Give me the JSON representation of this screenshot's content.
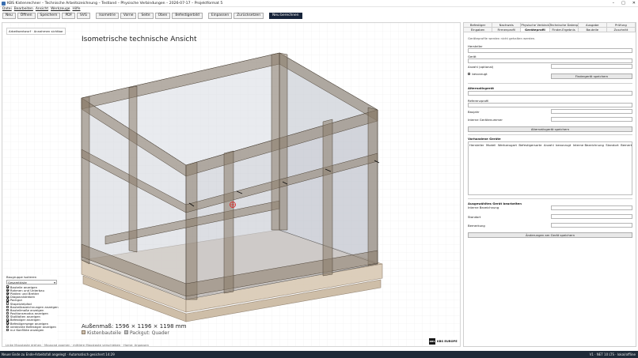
{
  "window": {
    "title": "KBS Kistenrechner – Technische Arbeitszeichnung – Testland – Physische Verbindungen – 2026-07-17 – Projektformat 5",
    "controls": [
      "–",
      "□",
      "✕"
    ]
  },
  "menu": [
    "Datei",
    "Bearbeiten",
    "Ansicht",
    "Werkzeuge",
    "Hilfe"
  ],
  "toolbar": {
    "new": "Neu",
    "open": "Öffnen",
    "save": "Speichern",
    "pdf": "PDF",
    "svg": "SVG",
    "isometric": "Isometrie",
    "front": "Vorne",
    "side": "Seite",
    "top": "Oben",
    "render": "Befestigerbild",
    "fit": "Einpassen",
    "reset": "Zurücksetzen",
    "recalc": "Neu berechnen"
  },
  "canvas": {
    "tab_label": "Arbeitsentwurf · Annahmen sichtbar",
    "title": "Isometrische technische Ansicht",
    "dimensions": "Außenmaß: 1596 × 1196 × 1198 mm",
    "legend": {
      "crate": "Kistenbauteile",
      "pack": "Packgut: Quader"
    },
    "logo_text": "KBS EUROPE",
    "logo_mark": "KBS",
    "hint": "Linke Maustaste drehen · Mausrad zoomen · mittlere Maustaste verschieben · Home: Anpassen"
  },
  "groups": {
    "title": "Baugruppe isolieren",
    "selected": "Gesamtkiste",
    "items": [
      {
        "label": "Bauteile anzeigen",
        "checked": true
      },
      {
        "label": "Rahmen und Unterbau",
        "checked": true
      },
      {
        "label": "Platten und Bretter",
        "checked": true
      },
      {
        "label": "Diagonalstreben",
        "checked": true
      },
      {
        "label": "Packgut",
        "checked": true
      },
      {
        "label": "Stapelzielpfad",
        "checked": false
      },
      {
        "label": "Bauteilbezeichnungen anzeigen",
        "checked": false
      },
      {
        "label": "Bauteilmaße anzeigen",
        "checked": false
      },
      {
        "label": "Positionsmodus anzeigen",
        "checked": false
      },
      {
        "label": "Stoßfalten anzeigen",
        "checked": false
      },
      {
        "label": "Befestiger anzeigen",
        "checked": true
      },
      {
        "label": "Befestigerwege anzeigen",
        "checked": true
      },
      {
        "label": "verdeckte Befestiger anzeigen",
        "checked": false
      },
      {
        "label": "nur Konflikte anzeigen",
        "checked": false
      }
    ]
  },
  "right_panel": {
    "tabs_row1": [
      "Befestiger",
      "Nachweis",
      "Physische Verbindungen",
      "Technische Datenpakete",
      "Ausgabe",
      "Prüfung"
    ],
    "tabs_row2": [
      "Eingaben",
      "Firmenprofil",
      "Geräteprofil",
      "Finder-Ergebnis",
      "Bauteile",
      "Zuschnitt"
    ],
    "active_tab": "Geräteprofil",
    "info": "Geräteprofile werden nicht gehalten werden.",
    "manufacturer_label": "Hersteller",
    "device_label": "Gerät",
    "count_label": "Anzahl (optional)",
    "preferred_label": "bevorzugt",
    "save_finder": "Findergerät speichern",
    "alt_title": "Alternativgerät",
    "reference_label": "Referenzprofil",
    "series_label": "Baujahr",
    "internal_no_label": "Interne Gerätenummer",
    "save_alt": "Alternativgerät speichern",
    "existing_title": "Vorhandene Geräte",
    "table_headers": [
      "Hersteller",
      "Modell",
      "Werkzeugart",
      "Befestigersorte",
      "Anzahl",
      "bevorzugt",
      "Interne Bezeichnung",
      "Standort",
      "Bemerkung",
      "Herk"
    ],
    "edit_title": "Ausgewähltes Gerät bearbeiten",
    "internal_name_label": "Interne Bezeichnung",
    "location_label": "Standort",
    "remark_label": "Bemerkung",
    "save_changes": "Änderungen am Gerät speichern"
  },
  "status": {
    "left": "Neuer Ende zu Ende-Arbeitsfall angelegt · Automatisch gesichert 14:29",
    "right": "V1 · NET 10 LTS · lokal/offline"
  }
}
